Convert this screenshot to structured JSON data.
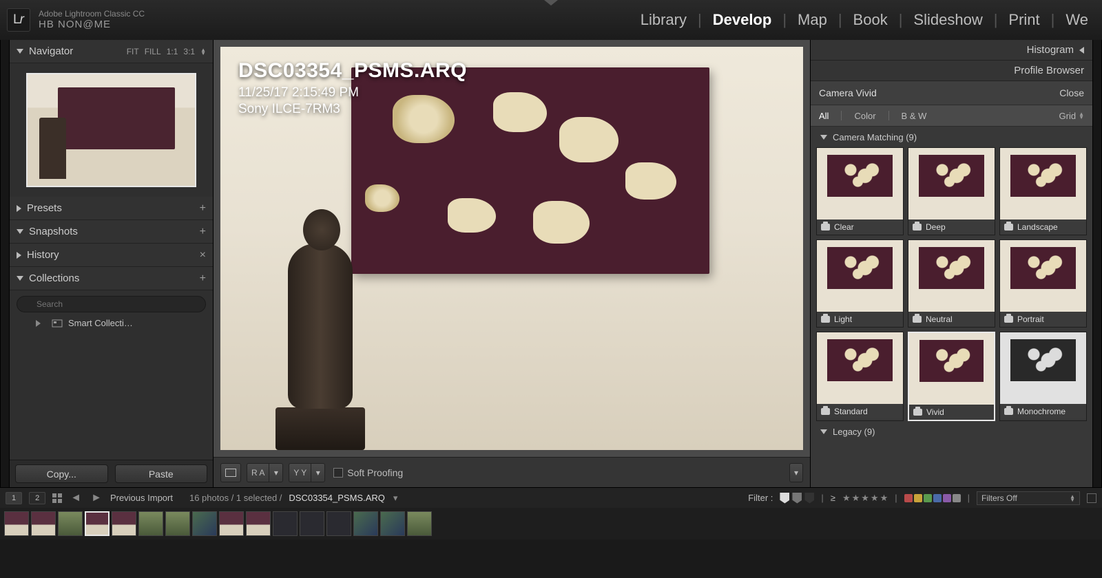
{
  "app": {
    "product": "Adobe Lightroom Classic CC",
    "subtitle": "HB NON@ME",
    "logo_l": "L",
    "logo_r": "r"
  },
  "modules": {
    "library": "Library",
    "develop": "Develop",
    "map": "Map",
    "book": "Book",
    "slideshow": "Slideshow",
    "print": "Print",
    "web": "We"
  },
  "nav": {
    "title": "Navigator",
    "fit": "FIT",
    "fill": "FILL",
    "r1": "1:1",
    "r2": "3:1"
  },
  "panels": {
    "presets": "Presets",
    "snapshots": "Snapshots",
    "history": "History",
    "collections": "Collections"
  },
  "collections": {
    "search_placeholder": "Search",
    "smart": "Smart Collecti…"
  },
  "buttons": {
    "copy": "Copy...",
    "paste": "Paste"
  },
  "overlay": {
    "filename": "DSC03354_PSMS.ARQ",
    "datetime": "11/25/17 2:15:49 PM",
    "camera": "Sony ILCE-7RM3"
  },
  "toolbar": {
    "ra": "R A",
    "yy": "Y Y",
    "soft": "Soft Proofing"
  },
  "right": {
    "histogram": "Histogram",
    "profile_browser": "Profile Browser",
    "current": "Camera Vivid",
    "close": "Close",
    "filters": {
      "all": "All",
      "color": "Color",
      "bw": "B & W",
      "grid": "Grid"
    },
    "group1": "Camera Matching (9)",
    "group2": "Legacy (9)",
    "profiles": [
      "Clear",
      "Deep",
      "Landscape",
      "Light",
      "Neutral",
      "Portrait",
      "Standard",
      "Vivid",
      "Monochrome"
    ]
  },
  "fsbar": {
    "s1": "1",
    "s2": "2",
    "source": "Previous Import",
    "count": "16 photos / 1 selected /",
    "file": "DSC03354_PSMS.ARQ",
    "filter_label": "Filter :",
    "ge": "≥",
    "filters_off": "Filters Off"
  },
  "colors": {
    "red": "#b84a4a",
    "yellow": "#c9a23a",
    "green": "#5a9a4e",
    "blue": "#4a6aa8",
    "purple": "#8a5aa8",
    "grey": "#888"
  }
}
